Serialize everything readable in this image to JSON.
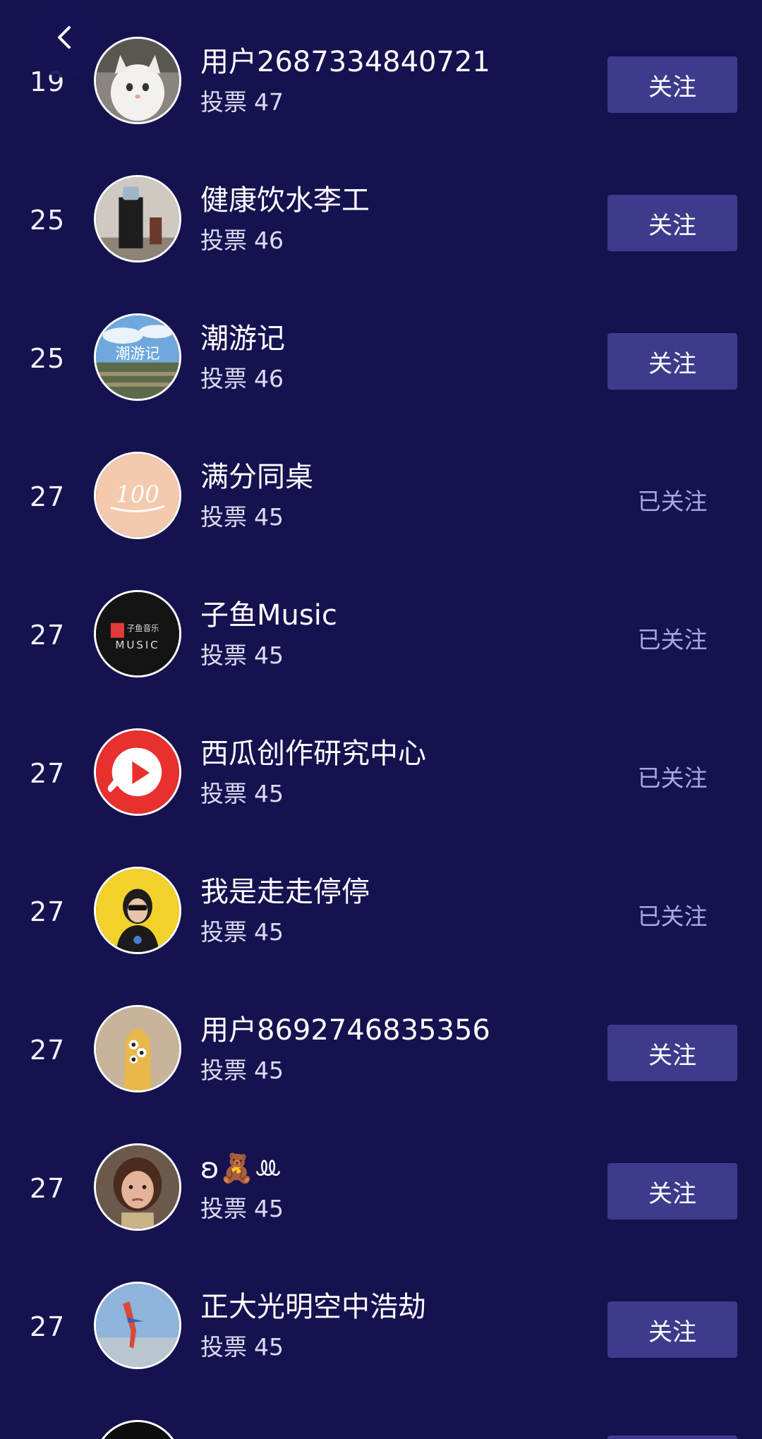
{
  "header": {
    "back_icon": "chevron-left-icon"
  },
  "vote_label": "投票",
  "follow_label": "关注",
  "followed_label": "已关注",
  "rows": [
    {
      "rank": "19",
      "name": "用户2687334840721",
      "votes": "47",
      "followed": false,
      "avatar": "cat-avatar"
    },
    {
      "rank": "25",
      "name": "健康饮水李工",
      "votes": "46",
      "followed": false,
      "avatar": "water-dispenser-avatar"
    },
    {
      "rank": "25",
      "name": "潮游记",
      "votes": "46",
      "followed": false,
      "avatar": "landscape-avatar",
      "avatar_text": "潮游记"
    },
    {
      "rank": "27",
      "name": "满分同桌",
      "votes": "45",
      "followed": true,
      "avatar": "score-100-avatar",
      "avatar_text": "100"
    },
    {
      "rank": "27",
      "name": "子鱼Music",
      "votes": "45",
      "followed": true,
      "avatar": "music-logo-avatar",
      "avatar_text": "MUSIC",
      "avatar_text2": "子鱼音乐"
    },
    {
      "rank": "27",
      "name": "西瓜创作研究中心",
      "votes": "45",
      "followed": true,
      "avatar": "xigua-play-avatar"
    },
    {
      "rank": "27",
      "name": "我是走走停停",
      "votes": "45",
      "followed": true,
      "avatar": "person-yellow-avatar"
    },
    {
      "rank": "27",
      "name": "用户8692746835356",
      "votes": "45",
      "followed": false,
      "avatar": "cartoon-avatar"
    },
    {
      "rank": "27",
      "name": "ʚ🧸ꔛ",
      "votes": "45",
      "followed": false,
      "avatar": "girl-avatar"
    },
    {
      "rank": "27",
      "name": "正大光明空中浩劫",
      "votes": "45",
      "followed": false,
      "avatar": "airplane-avatar"
    }
  ],
  "colors": {
    "background": "#16114f",
    "button": "#3e3b8c",
    "followed_text": "#a9a6e6"
  }
}
